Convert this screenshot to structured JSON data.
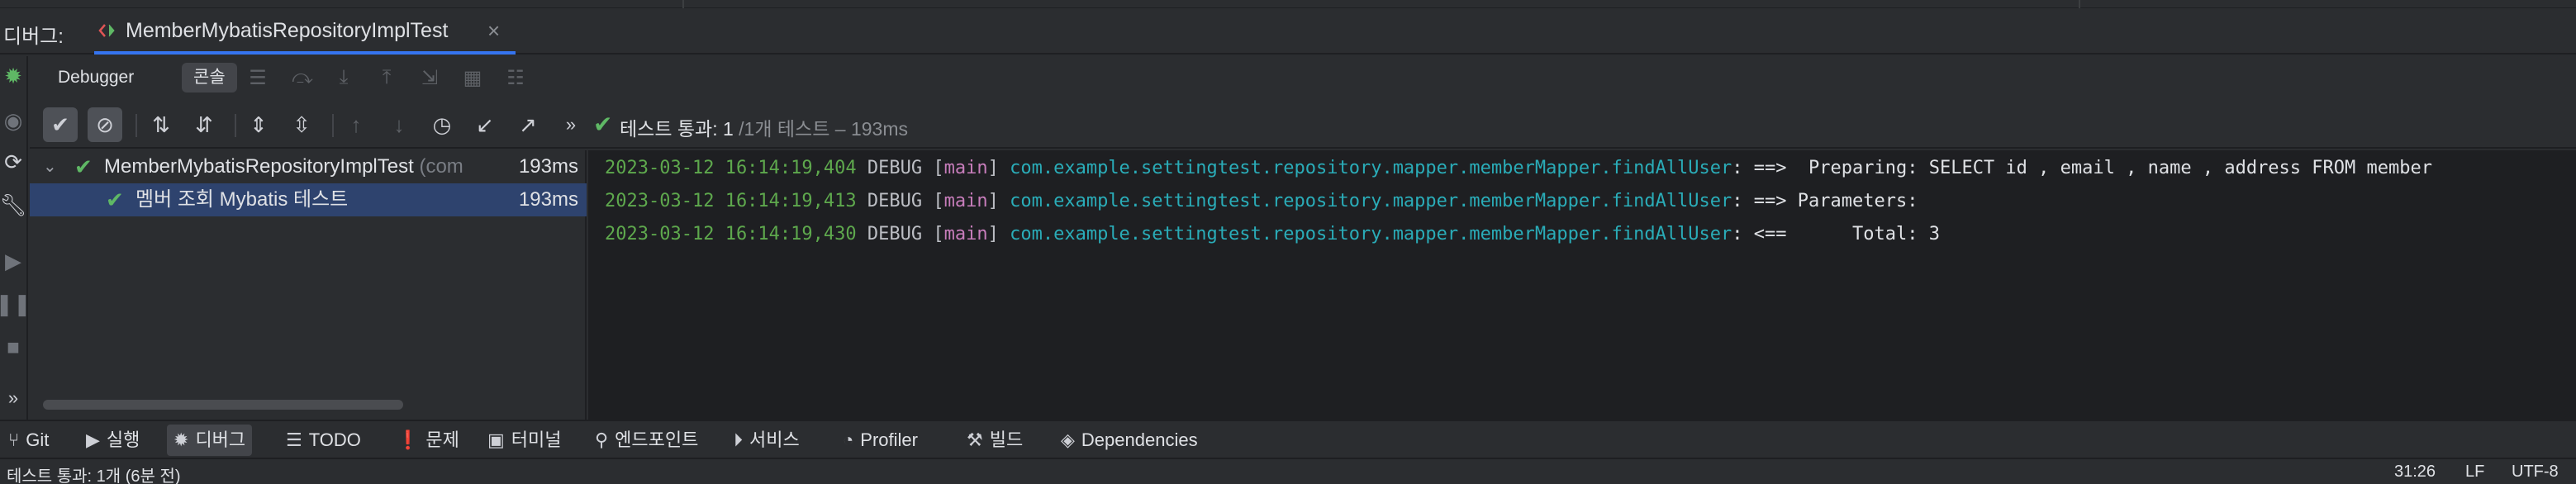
{
  "debug": {
    "label": "디버그:",
    "run_config_tab": {
      "title": "MemberMybatisRepositoryImplTest",
      "close": "×"
    }
  },
  "subtabs": {
    "debugger": "Debugger",
    "console": "콘솔"
  },
  "test_status": {
    "text": "테스트 통과: 1",
    "detail": "/1개 테스트 – 193ms"
  },
  "tree": {
    "root": {
      "name": "MemberMybatisRepositoryImplTest",
      "suffix": "(com",
      "duration": "193ms"
    },
    "child": {
      "name": "멤버 조회 Mybatis 테스트",
      "duration": "193ms"
    }
  },
  "console": {
    "lines": [
      {
        "timestamp": "2023-03-12 16:14:19,404",
        "level": "DEBUG",
        "thread": "main",
        "logger": "com.example.settingtest.repository.mapper.memberMapper.findAllUser",
        "message": ": ==>  Preparing: SELECT id , email , name , address FROM member"
      },
      {
        "timestamp": "2023-03-12 16:14:19,413",
        "level": "DEBUG",
        "thread": "main",
        "logger": "com.example.settingtest.repository.mapper.memberMapper.findAllUser",
        "message": ": ==> Parameters: "
      },
      {
        "timestamp": "2023-03-12 16:14:19,430",
        "level": "DEBUG",
        "thread": "main",
        "logger": "com.example.settingtest.repository.mapper.memberMapper.findAllUser",
        "message": ": <==      Total: 3"
      }
    ]
  },
  "toolwindows": {
    "git": "Git",
    "run": "실행",
    "debug": "디버그",
    "todo": "TODO",
    "problems": "문제",
    "terminal": "터미널",
    "endpoints": "엔드포인트",
    "services": "서비스",
    "profiler": "Profiler",
    "build": "빌드",
    "dependencies": "Dependencies"
  },
  "statusbar": {
    "message": "테스트 통과: 1개 (6분 전)",
    "position": "31:26",
    "line_separator": "LF",
    "encoding": "UTF-8"
  },
  "colors": {
    "accent": "#3574f0",
    "success": "#5fb865",
    "timestamp": "#5ea84d",
    "thread": "#c77dbb",
    "logger": "#2aacb8"
  }
}
